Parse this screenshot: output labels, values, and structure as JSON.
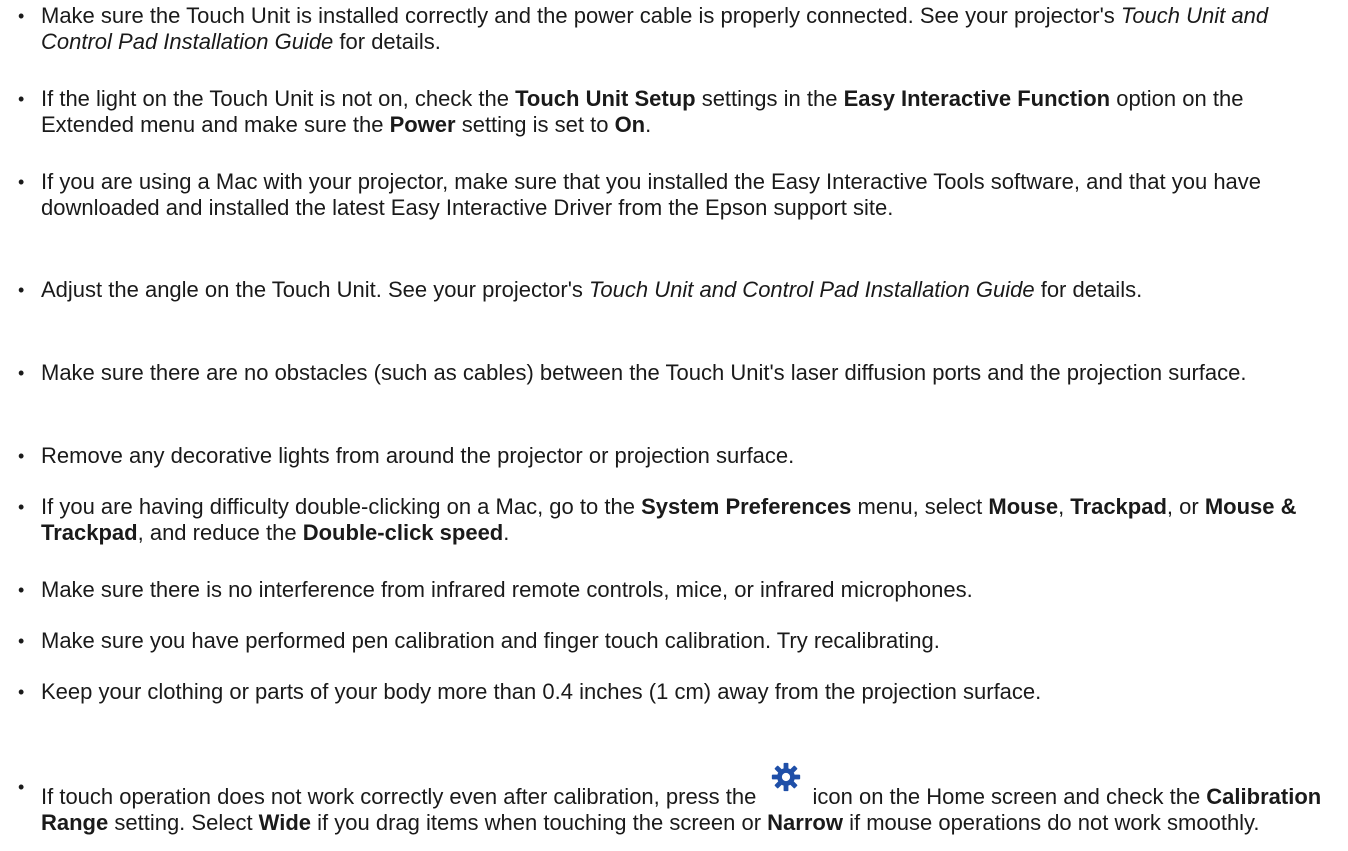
{
  "bullet_char": "•",
  "items": [
    [
      {
        "t": "Make sure the Touch Unit is installed correctly and the power cable is properly connected. See your projector's "
      },
      {
        "t": "Touch Unit and Control Pad Installation Guide",
        "s": "i"
      },
      {
        "t": " for details."
      }
    ],
    [
      {
        "t": "If the light on the Touch Unit is not on, check the "
      },
      {
        "t": "Touch Unit Setup",
        "s": "b"
      },
      {
        "t": " settings in the "
      },
      {
        "t": "Easy Interactive Function",
        "s": "b"
      },
      {
        "t": " option on the Extended menu and make sure the "
      },
      {
        "t": "Power",
        "s": "b"
      },
      {
        "t": " setting is set to "
      },
      {
        "t": "On",
        "s": "b"
      },
      {
        "t": "."
      }
    ],
    [
      {
        "t": "If you are using a Mac with your projector, make sure that you installed the Easy Interactive Tools software, and that you have downloaded and installed the latest Easy Interactive Driver from the Epson support site."
      }
    ],
    [
      {
        "t": "Adjust the angle on the Touch Unit. See your projector's "
      },
      {
        "t": "Touch Unit and Control Pad Installation Guide",
        "s": "i"
      },
      {
        "t": " for details."
      }
    ],
    [
      {
        "t": "Make sure there are no obstacles (such as cables) between the Touch Unit's laser diffusion ports and the projection surface."
      }
    ],
    [
      {
        "t": "Remove any decorative lights from around the projector or projection surface."
      }
    ],
    [
      {
        "t": "If you are having difficulty double-clicking on a Mac, go to the "
      },
      {
        "t": "System Preferences",
        "s": "b"
      },
      {
        "t": " menu, select "
      },
      {
        "t": "Mouse",
        "s": "b"
      },
      {
        "t": ", "
      },
      {
        "t": "Trackpad",
        "s": "b"
      },
      {
        "t": ", or "
      },
      {
        "t": "Mouse & Trackpad",
        "s": "b"
      },
      {
        "t": ", and reduce the "
      },
      {
        "t": "Double-click speed",
        "s": "b"
      },
      {
        "t": "."
      }
    ],
    [
      {
        "t": "Make sure there is no interference from infrared remote controls, mice, or infrared microphones."
      }
    ],
    [
      {
        "t": "Make sure you have performed pen calibration and finger touch calibration. Try recalibrating."
      }
    ],
    [
      {
        "t": "Keep your clothing or parts of your body more than 0.4 inches (1 cm) away from the projection surface."
      }
    ],
    [
      {
        "t": "If touch operation does not work correctly even after calibration, press the "
      },
      {
        "icon": "gear-icon",
        "color": "#1f4fa8"
      },
      {
        "t": "icon on the Home screen and check the "
      },
      {
        "t": "Calibration Range",
        "s": "b"
      },
      {
        "t": " setting. Select "
      },
      {
        "t": "Wide",
        "s": "b"
      },
      {
        "t": " if you drag items when touching the screen or "
      },
      {
        "t": "Narrow",
        "s": "b"
      },
      {
        "t": " if mouse operations do not work smoothly."
      }
    ]
  ]
}
